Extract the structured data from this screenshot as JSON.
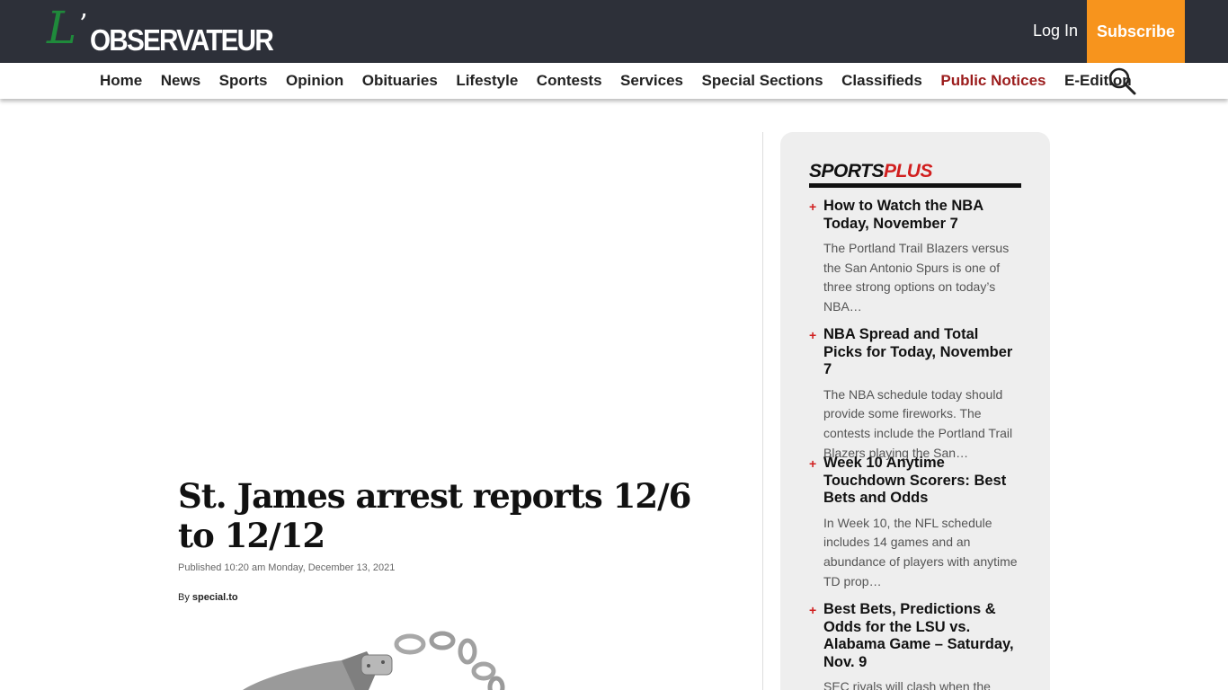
{
  "header": {
    "logo_text": "L'OBSERVATEUR",
    "login_label": "Log In",
    "subscribe_label": "Subscribe"
  },
  "nav": {
    "items": [
      {
        "label": "Home"
      },
      {
        "label": "News"
      },
      {
        "label": "Sports"
      },
      {
        "label": "Opinion"
      },
      {
        "label": "Obituaries"
      },
      {
        "label": "Lifestyle"
      },
      {
        "label": "Contests"
      },
      {
        "label": "Services"
      },
      {
        "label": "Special Sections"
      },
      {
        "label": "Classifieds"
      },
      {
        "label": "Public Notices"
      },
      {
        "label": "E-Edition"
      }
    ],
    "search_icon": "search-icon"
  },
  "article": {
    "headline": "St. James arrest reports 12/6 to 12/12",
    "published": "Published 10:20 am Monday, December 13, 2021",
    "byline_prefix": "By",
    "byline_author": "special.to",
    "image_icon": "handcuffs-image"
  },
  "sidebar": {
    "title_part1": "SPORTS",
    "title_part2": "PLUS",
    "items": [
      {
        "headline": "How to Watch the NBA Today, November 7",
        "desc": "The Portland Trail Blazers versus the San Antonio Spurs is one of three strong options on today’s NBA…"
      },
      {
        "headline": "NBA Spread and Total Picks for Today, November 7",
        "desc": "The NBA schedule today should provide some fireworks. The contests include the Portland Trail Blazers playing the San…"
      },
      {
        "headline": "Week 10 Anytime Touchdown Scorers: Best Bets and Odds",
        "desc": "In Week 10, the NFL schedule includes 14 games and an abundance of players with anytime TD prop…"
      },
      {
        "headline": "Best Bets, Predictions & Odds for the LSU vs. Alabama Game – Saturday, Nov. 9",
        "desc": "SEC rivals will clash when the"
      }
    ]
  },
  "colors": {
    "topbar": "#2d3039",
    "subscribe": "#f7941d",
    "accent_red": "#d11f1f",
    "public_notices": "#9b1c1c"
  }
}
